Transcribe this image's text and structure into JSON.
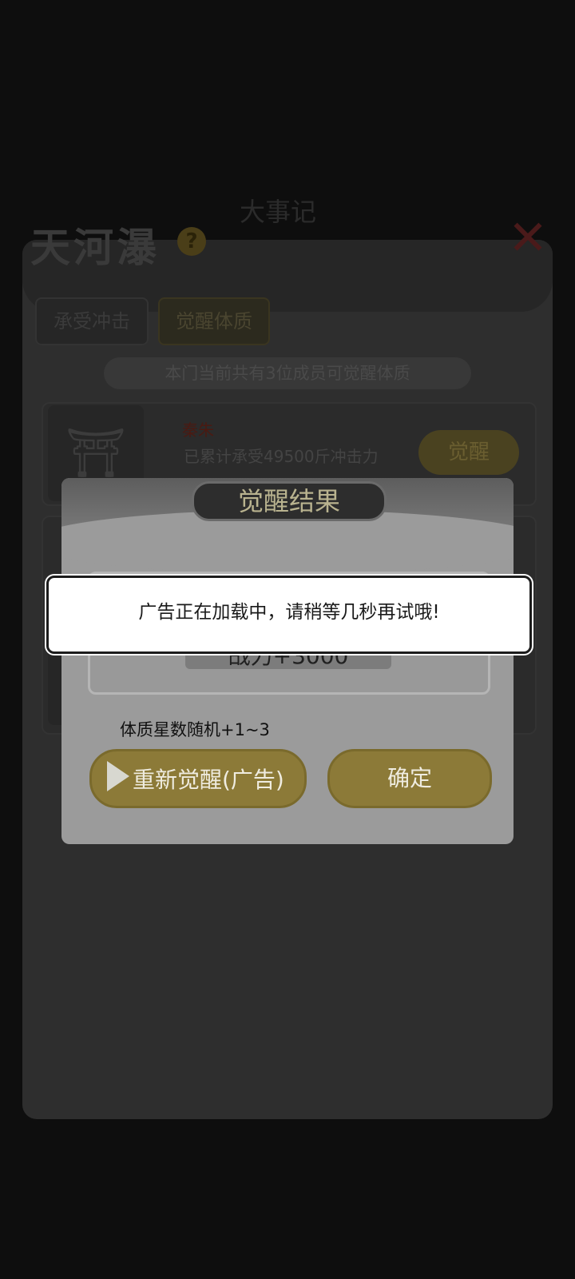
{
  "background": {
    "top_banner": "大事记",
    "game_title": "天河瀑",
    "help_icon": "?",
    "tabs": [
      "承受冲击",
      "觉醒体质"
    ],
    "notice": "本门当前共有3位成员可觉醒体质",
    "member": {
      "name": "秦朱",
      "desc": "已累计承受49500斤冲击力",
      "awaken_label": "觉醒"
    }
  },
  "dialog": {
    "title": "觉醒结果",
    "power_text": "战力+3000",
    "stars_text": "体质星数随机+1~3",
    "readawaken_label": "重新觉醒(广告)",
    "confirm_label": "确定"
  },
  "toast": {
    "message": "广告正在加载中，请稍等几秒再试哦!"
  }
}
